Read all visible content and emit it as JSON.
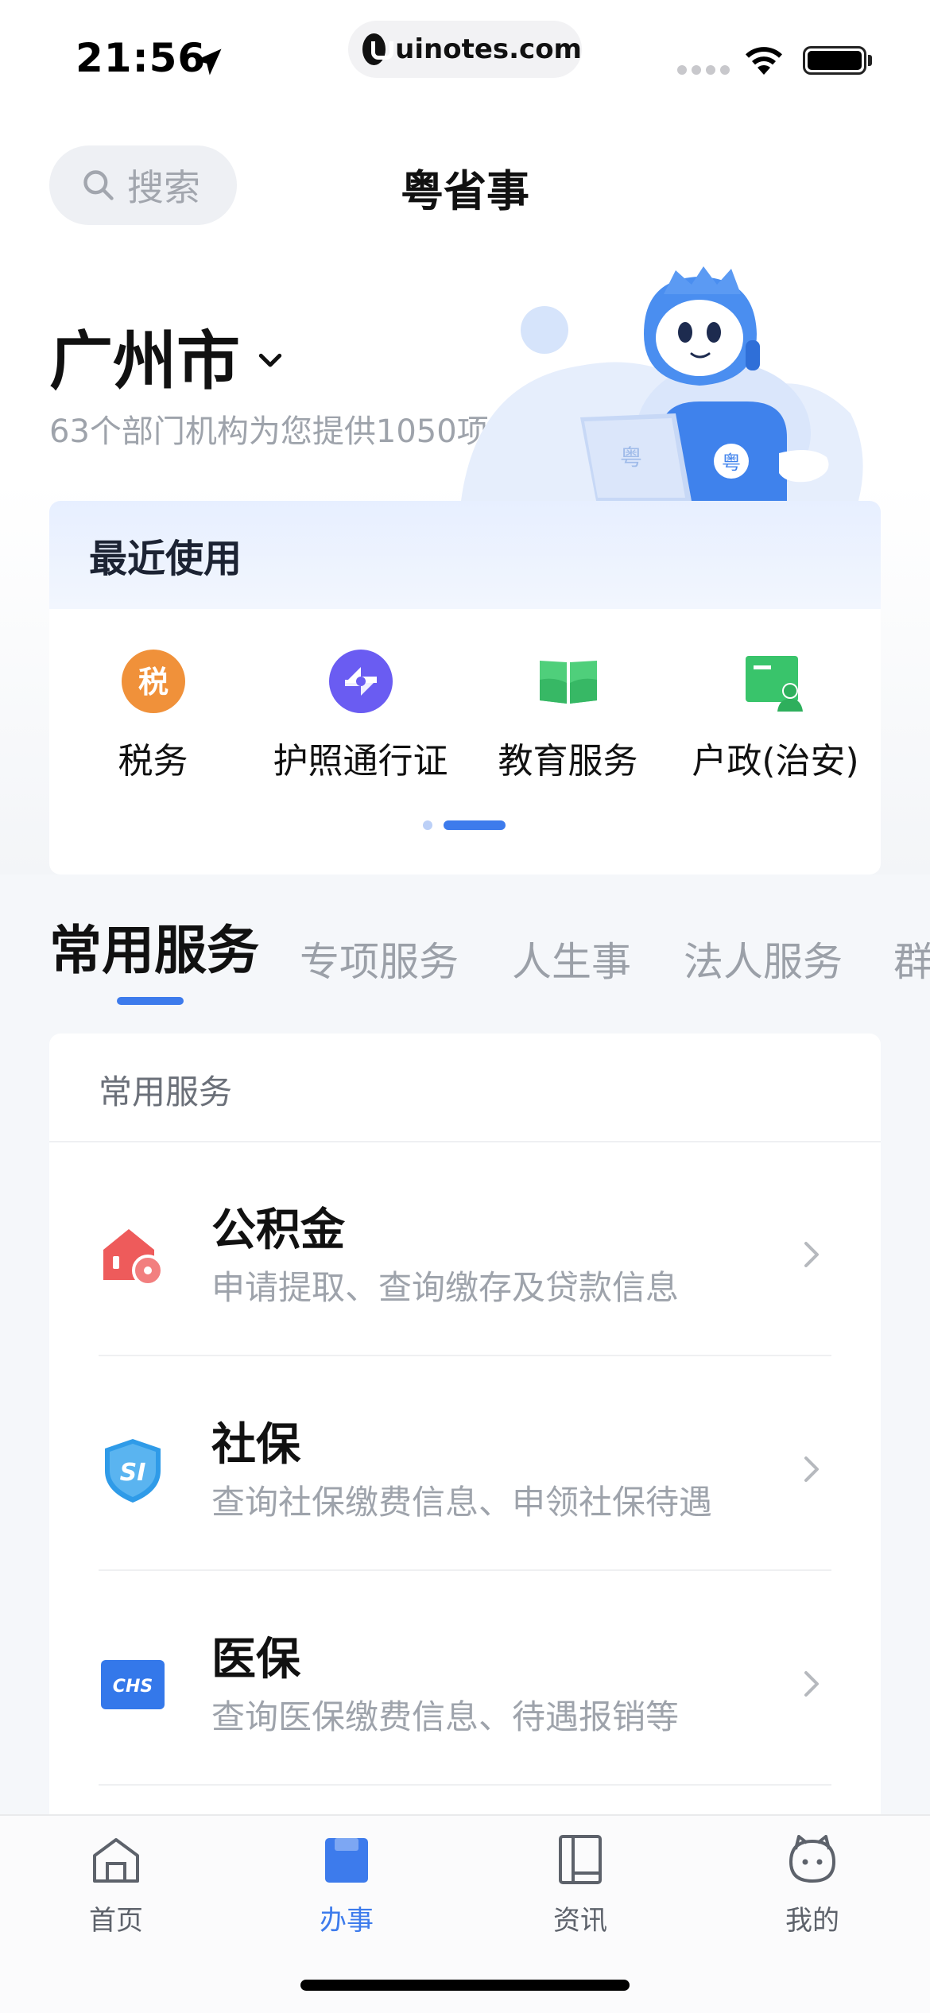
{
  "status_bar": {
    "time": "21:56",
    "url": "uinotes.com",
    "icons": [
      "location-arrow-icon",
      "signal-icon",
      "wifi-icon",
      "battery-icon"
    ]
  },
  "header": {
    "search_label": "搜索",
    "title": "粤省事"
  },
  "hero": {
    "city": "广州市",
    "subtitle": "63个部门机构为您提供1050项服务"
  },
  "recent": {
    "title": "最近使用",
    "items": [
      {
        "label": "税务",
        "icon": "tax-icon",
        "icon_text": "税",
        "color": "#f0913a"
      },
      {
        "label": "护照通行证",
        "icon": "passport-icon",
        "color": "#6a5cf2"
      },
      {
        "label": "教育服务",
        "icon": "book-icon",
        "color": "#4fcf7b"
      },
      {
        "label": "户政(治安)",
        "icon": "household-icon",
        "color": "#39c46b"
      }
    ],
    "page_count": 2,
    "current_page": 2
  },
  "tabs": [
    {
      "label": "常用服务",
      "active": true
    },
    {
      "label": "专项服务",
      "active": false
    },
    {
      "label": "人生事",
      "active": false
    },
    {
      "label": "法人服务",
      "active": false
    },
    {
      "label": "群",
      "active": false
    }
  ],
  "services": {
    "section_title": "常用服务",
    "items": [
      {
        "name": "公积金",
        "desc": "申请提取、查询缴存及贷款信息",
        "icon": "housing-fund-icon",
        "color": "#ee5b5b"
      },
      {
        "name": "社保",
        "desc": "查询社保缴费信息、申领社保待遇",
        "icon": "social-security-icon",
        "icon_text": "SI",
        "color": "#2f9be8"
      },
      {
        "name": "医保",
        "desc": "查询医保缴费信息、待遇报销等",
        "icon": "medical-insurance-icon",
        "icon_text": "CHS",
        "color": "#3478ea"
      }
    ]
  },
  "bottom_nav": [
    {
      "label": "首页",
      "icon": "home-icon",
      "active": false
    },
    {
      "label": "办事",
      "icon": "service-icon",
      "active": true
    },
    {
      "label": "资讯",
      "icon": "news-icon",
      "active": false
    },
    {
      "label": "我的",
      "icon": "profile-icon",
      "active": false
    }
  ],
  "colors": {
    "accent": "#3d7bec",
    "inactive_text": "#9ea3ab"
  }
}
